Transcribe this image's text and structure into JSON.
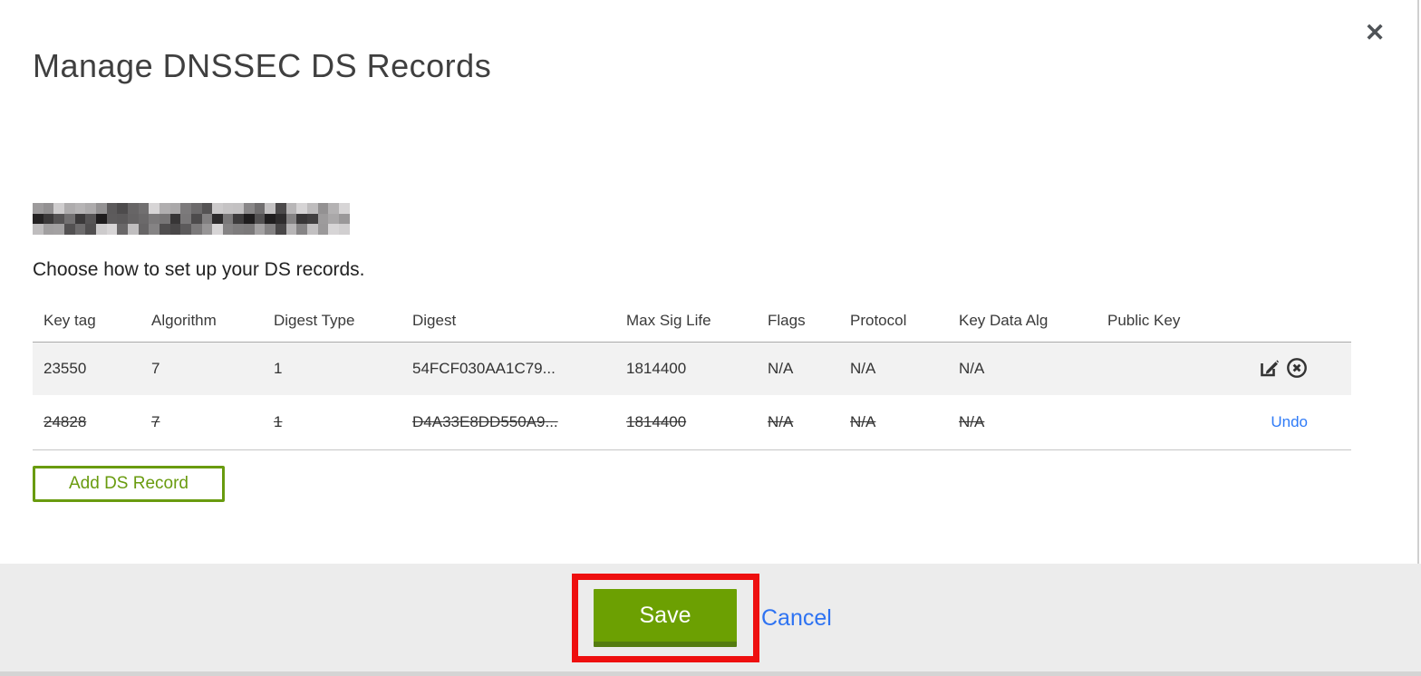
{
  "modal": {
    "title": "Manage DNSSEC DS Records",
    "close_icon": "✕",
    "domain": {
      "redacted": true
    },
    "subtitle": "Choose how to set up your DS records.",
    "table": {
      "columns": [
        "Key tag",
        "Algorithm",
        "Digest Type",
        "Digest",
        "Max Sig Life",
        "Flags",
        "Protocol",
        "Key Data Alg",
        "Public Key"
      ],
      "rows": [
        {
          "key_tag": "23550",
          "algorithm": "7",
          "digest_type": "1",
          "digest": "54FCF030AA1C79...",
          "max_sig_life": "1814400",
          "flags": "N/A",
          "protocol": "N/A",
          "key_data_alg": "N/A",
          "public_key": "",
          "state": "active",
          "actions": [
            "edit",
            "delete"
          ]
        },
        {
          "key_tag": "24828",
          "algorithm": "7",
          "digest_type": "1",
          "digest": "D4A33E8DD550A9...",
          "max_sig_life": "1814400",
          "flags": "N/A",
          "protocol": "N/A",
          "key_data_alg": "N/A",
          "public_key": "",
          "state": "marked-for-deletion",
          "undo_label": "Undo"
        }
      ]
    },
    "add_button_label": "Add DS Record",
    "footer": {
      "save_label": "Save",
      "cancel_label": "Cancel"
    },
    "colors": {
      "button_green": "#6CA002",
      "outline_green": "#699B0F",
      "link_blue": "#2E73F2",
      "annotation_red": "#EE0F0F"
    }
  }
}
